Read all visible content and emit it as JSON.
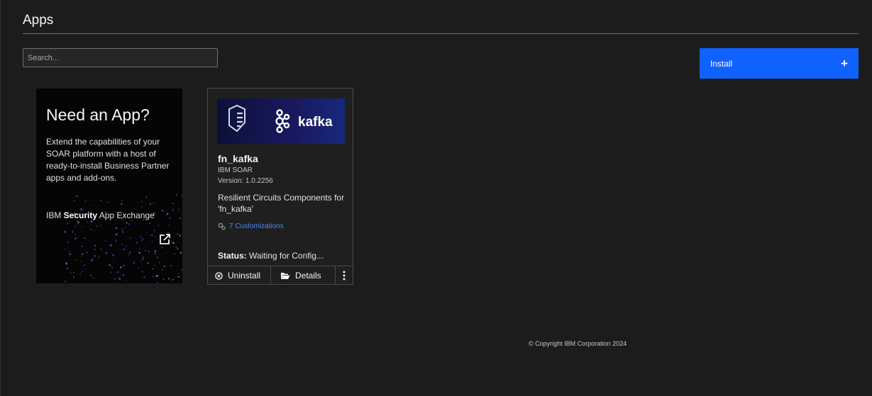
{
  "page": {
    "title": "Apps"
  },
  "search": {
    "placeholder": "Search..."
  },
  "install": {
    "label": "Install",
    "icon": "plus-icon"
  },
  "promo": {
    "heading": "Need an App?",
    "body": "Extend the capabilities of your SOAR platform with a host of ready-to-install Business Partner apps and add-ons.",
    "brand_prefix": "IBM ",
    "brand_bold": "Security",
    "brand_suffix": " App Exchange",
    "icon": "external-link-icon"
  },
  "app_card": {
    "banner_text": "kafka",
    "name": "fn_kafka",
    "vendor": "IBM SOAR",
    "version": "Version: 1.0.2256",
    "description": "Resilient Circuits Components for 'fn_kafka'",
    "customizations": "7 Customizations",
    "status_label": "Status:",
    "status_value": "Waiting for Config...",
    "actions": {
      "uninstall": "Uninstall",
      "details": "Details"
    }
  },
  "footer": {
    "copyright": "© Copyright IBM Corporation 2024"
  },
  "colors": {
    "accent": "#0f62fe",
    "link": "#4589ff",
    "background": "#1c1c1c"
  }
}
